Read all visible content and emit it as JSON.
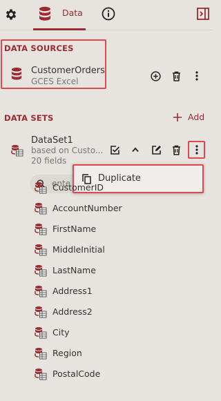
{
  "header": {
    "tabs": [
      {
        "label": "",
        "icon": "gear-icon"
      },
      {
        "label": "Data",
        "icon": "database-icon",
        "active": true
      },
      {
        "label": "",
        "icon": "info-icon"
      }
    ],
    "collapse_icon": "panel-collapse-icon"
  },
  "data_sources": {
    "title": "DATA SOURCES",
    "items": [
      {
        "name": "CustomerOrders",
        "type": "GCES Excel"
      }
    ]
  },
  "data_sets": {
    "title": "DATA SETS",
    "add_label": "Add",
    "items": [
      {
        "name": "DataSet1",
        "based_on": "based on Custo...",
        "field_count": "20 fields"
      }
    ]
  },
  "search": {
    "placeholder": "ente"
  },
  "context_menu": {
    "items": [
      {
        "label": "Duplicate"
      }
    ]
  },
  "fields": [
    "CustomerID",
    "AccountNumber",
    "FirstName",
    "MiddleInitial",
    "LastName",
    "Address1",
    "Address2",
    "City",
    "Region",
    "PostalCode"
  ],
  "colors": {
    "accent": "#9b2a33",
    "highlight": "#e2474f",
    "background": "#e7e3de"
  }
}
